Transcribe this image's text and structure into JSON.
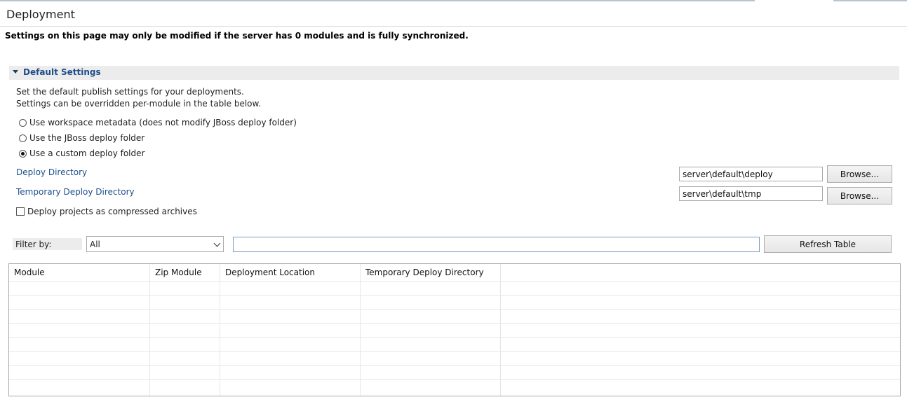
{
  "header": {
    "title": "Deployment"
  },
  "notice": "Settings on this page may only be modified if the server has 0 modules and is fully synchronized.",
  "section": {
    "title": "Default Settings",
    "desc_line1": "Set the default publish settings for your deployments.",
    "desc_line2": "Settings can be overridden per-module in the table below."
  },
  "radios": [
    {
      "label": "Use workspace metadata (does not modify JBoss deploy folder)",
      "checked": false
    },
    {
      "label": "Use the JBoss deploy folder",
      "checked": false
    },
    {
      "label": "Use a custom deploy folder",
      "checked": true
    }
  ],
  "deploy_dir": {
    "label": "Deploy Directory",
    "value": "server\\default\\deploy",
    "browse_label": "Browse..."
  },
  "temp_dir": {
    "label": "Temporary Deploy Directory",
    "value": "server\\default\\tmp",
    "browse_label": "Browse..."
  },
  "compress_checkbox": {
    "label": "Deploy projects as compressed archives",
    "checked": false
  },
  "filter": {
    "label": "Filter by:",
    "selected": "All",
    "text": "",
    "refresh_label": "Refresh Table"
  },
  "table": {
    "columns": [
      "Module",
      "Zip Module",
      "Deployment Location",
      "Temporary Deploy Directory"
    ],
    "rows": []
  }
}
